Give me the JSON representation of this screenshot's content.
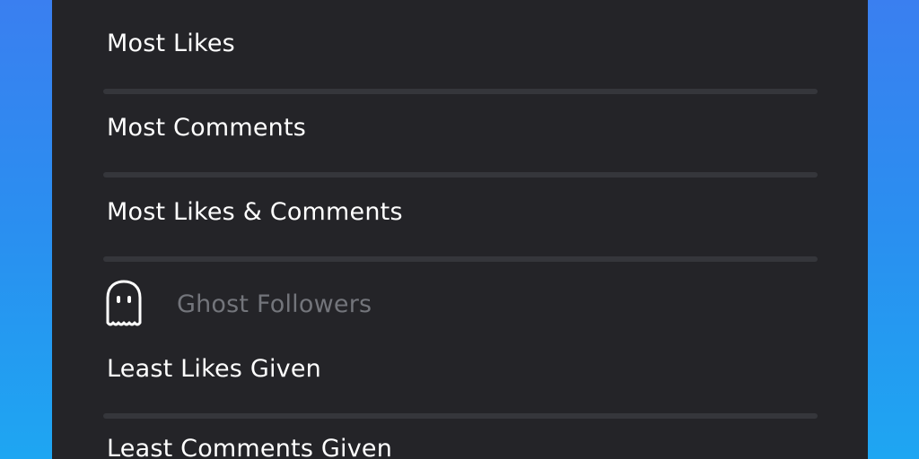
{
  "sort_menu": {
    "items": [
      {
        "label": "Most Likes"
      },
      {
        "label": "Most Comments"
      },
      {
        "label": "Most Likes & Comments"
      }
    ]
  },
  "ghost_followers_section": {
    "title": "Ghost Followers",
    "icon": "ghost-icon",
    "items": [
      {
        "label": "Least Likes Given"
      },
      {
        "label": "Least Comments Given"
      }
    ]
  },
  "colors": {
    "panel_bg": "#242428",
    "separator": "#35363b",
    "text_primary": "#ffffff",
    "text_secondary": "#73757b",
    "background_gradient_top": "#3a7ff0",
    "background_gradient_bottom": "#1ea6f2"
  }
}
